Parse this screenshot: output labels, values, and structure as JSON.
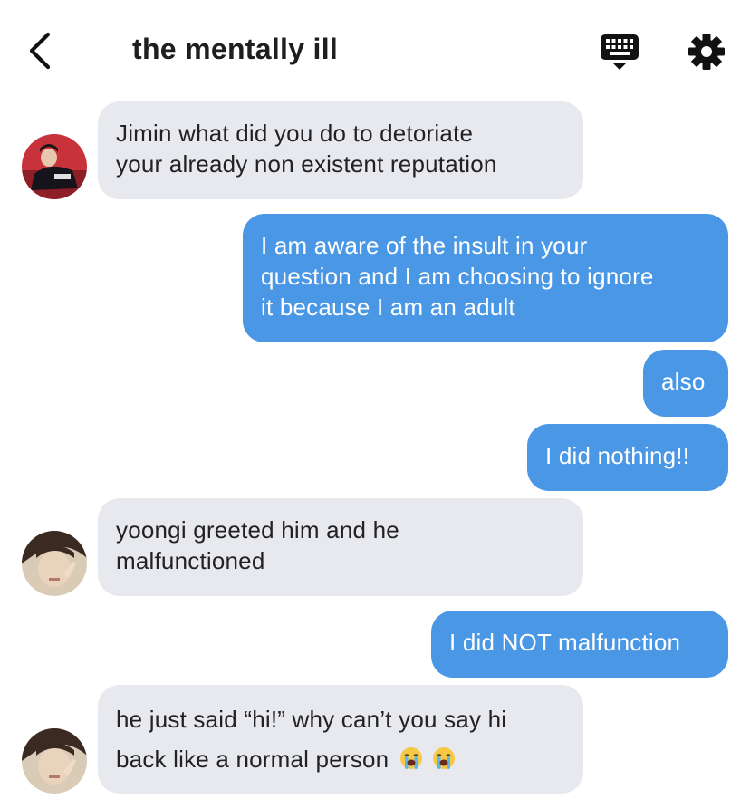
{
  "header": {
    "title": "the mentally ill",
    "back_icon": "chevron-left-icon",
    "keyboard_icon": "keyboard-icon",
    "settings_icon": "gear-icon"
  },
  "colors": {
    "outgoing_bubble": "#4a97e6",
    "incoming_bubble": "#e8e9ee",
    "text_dark": "#1e1e1e",
    "text_light": "#ffffff"
  },
  "messages": [
    {
      "side": "incoming",
      "lines": [
        "Jimin what did you do to detoriate",
        "your already non existent reputation"
      ]
    },
    {
      "side": "outgoing",
      "lines": [
        "I am aware of the insult in your",
        "question and I am choosing to ignore",
        "it because I am an adult"
      ]
    },
    {
      "side": "outgoing",
      "lines": [
        "also"
      ]
    },
    {
      "side": "outgoing",
      "lines": [
        "I did nothing!!"
      ]
    },
    {
      "side": "incoming",
      "lines": [
        "yoongi greeted him and he",
        "malfunctioned"
      ]
    },
    {
      "side": "outgoing",
      "lines": [
        "I did NOT malfunction"
      ]
    },
    {
      "side": "incoming",
      "lines": [
        "he just said “hi!” why can’t you say hi",
        "back like a normal person"
      ],
      "emoji": [
        "loudly-crying-face-icon",
        "loudly-crying-face-icon"
      ]
    }
  ]
}
